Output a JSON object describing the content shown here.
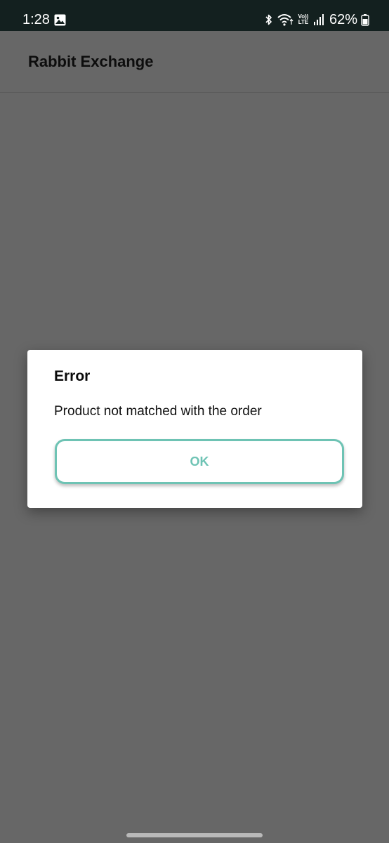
{
  "status_bar": {
    "time": "1:28",
    "volte_top": "Vo))",
    "volte_bottom": "LTE",
    "battery_percent": "62%",
    "icons": [
      "gallery-icon",
      "bluetooth-icon",
      "wifi-icon",
      "volte-icon",
      "signal-icon",
      "battery-icon"
    ]
  },
  "app_bar": {
    "title": "Rabbit Exchange"
  },
  "dialog": {
    "title": "Error",
    "message": "Product not matched with the order",
    "ok_label": "OK"
  },
  "colors": {
    "status_bar_bg": "#13201f",
    "scrim": "#676767",
    "dialog_bg": "#ffffff",
    "accent": "#6ec3b4"
  }
}
